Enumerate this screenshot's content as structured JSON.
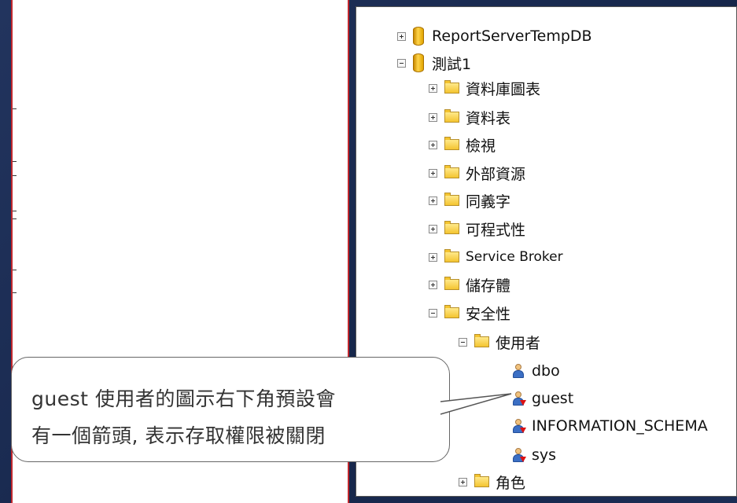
{
  "tree": {
    "items": [
      {
        "label": "ReportServerTempDB",
        "icon": "database-icon",
        "expanded": false
      },
      {
        "label": "測試1",
        "icon": "database-icon",
        "expanded": true
      },
      {
        "label": "資料庫圖表",
        "icon": "folder-icon",
        "expanded": false
      },
      {
        "label": "資料表",
        "icon": "folder-icon",
        "expanded": false
      },
      {
        "label": "檢視",
        "icon": "folder-icon",
        "expanded": false
      },
      {
        "label": "外部資源",
        "icon": "folder-icon",
        "expanded": false
      },
      {
        "label": "同義字",
        "icon": "folder-icon",
        "expanded": false
      },
      {
        "label": "可程式性",
        "icon": "folder-icon",
        "expanded": false
      },
      {
        "label": "Service Broker",
        "icon": "folder-icon",
        "expanded": false
      },
      {
        "label": "儲存體",
        "icon": "folder-icon",
        "expanded": false
      },
      {
        "label": "安全性",
        "icon": "folder-icon",
        "expanded": true
      },
      {
        "label": "使用者",
        "icon": "folder-icon",
        "expanded": true
      },
      {
        "label": "dbo",
        "icon": "user-icon"
      },
      {
        "label": "guest",
        "icon": "user-disabled-icon"
      },
      {
        "label": "INFORMATION_SCHEMA",
        "icon": "user-disabled-icon"
      },
      {
        "label": "sys",
        "icon": "user-disabled-icon"
      },
      {
        "label": "角色",
        "icon": "folder-icon",
        "expanded": false
      }
    ]
  },
  "callout": {
    "line1": "guest 使用者的圖示右下角預設會",
    "line2": "有一個箭頭, 表示存取權限被關閉"
  },
  "colors": {
    "frame_bg": "#1c2c52",
    "accent_red": "#c0272d",
    "folder": "#f4c430",
    "db": "#ffd44a"
  }
}
